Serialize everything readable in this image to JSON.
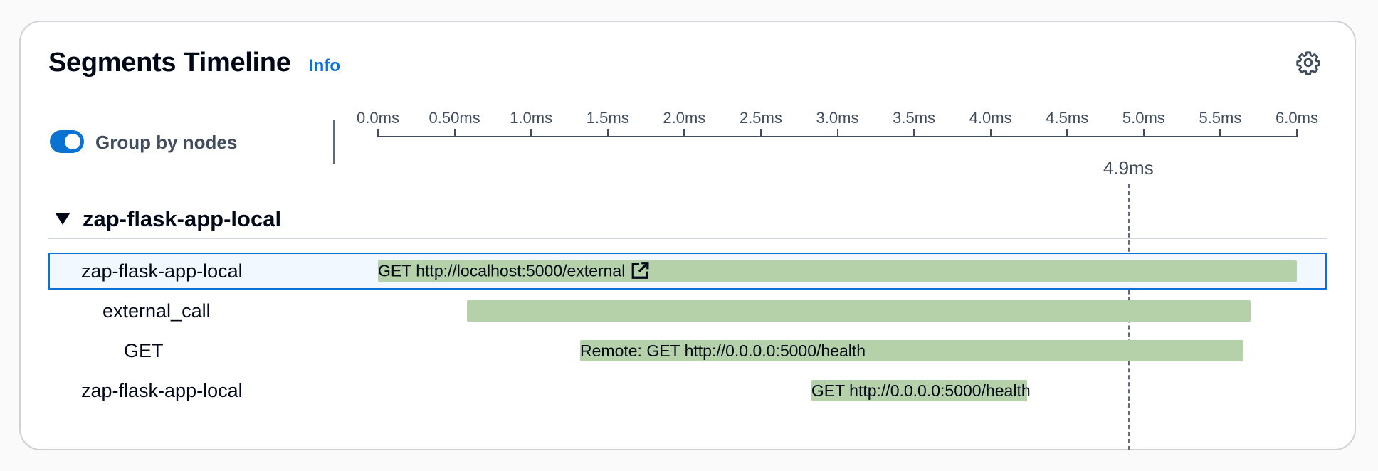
{
  "header": {
    "title": "Segments Timeline",
    "info_label": "Info",
    "settings_icon": "gear-icon"
  },
  "toolbar": {
    "group_by_nodes_label": "Group by nodes",
    "group_by_nodes_enabled": true
  },
  "colors": {
    "accent": "#0972d3",
    "bar": "#b4d1a9",
    "selected_row_bg": "#f1f8ff"
  },
  "timeline": {
    "ticks_ms": [
      0.0,
      0.5,
      1.0,
      1.5,
      2.0,
      2.5,
      3.0,
      3.5,
      4.0,
      4.5,
      5.0,
      5.5,
      6.0
    ],
    "tick_labels": [
      "0.0ms",
      "0.50ms",
      "1.0ms",
      "1.5ms",
      "2.0ms",
      "2.5ms",
      "3.0ms",
      "3.5ms",
      "4.0ms",
      "4.5ms",
      "5.0ms",
      "5.5ms",
      "6.0ms"
    ],
    "range_ms": [
      0.0,
      6.0
    ],
    "cursor_ms": 4.9,
    "cursor_label": "4.9ms"
  },
  "group": {
    "label": "zap-flask-app-local",
    "expanded": true
  },
  "rows": [
    {
      "name": "zap-flask-app-local",
      "indent": 0,
      "start_ms": 0.0,
      "end_ms": 6.0,
      "label": "GET http://localhost:5000/external",
      "external_link_icon": "external-link-icon",
      "selected": true
    },
    {
      "name": "external_call",
      "indent": 1,
      "start_ms": 0.58,
      "end_ms": 5.7,
      "label": "",
      "selected": false
    },
    {
      "name": "GET",
      "indent": 2,
      "start_ms": 1.32,
      "end_ms": 5.65,
      "label": "Remote: GET http://0.0.0.0:5000/health",
      "selected": false
    },
    {
      "name": "zap-flask-app-local",
      "indent": 0,
      "start_ms": 2.83,
      "end_ms": 4.24,
      "label": "GET http://0.0.0.0:5000/health",
      "selected": false
    }
  ]
}
